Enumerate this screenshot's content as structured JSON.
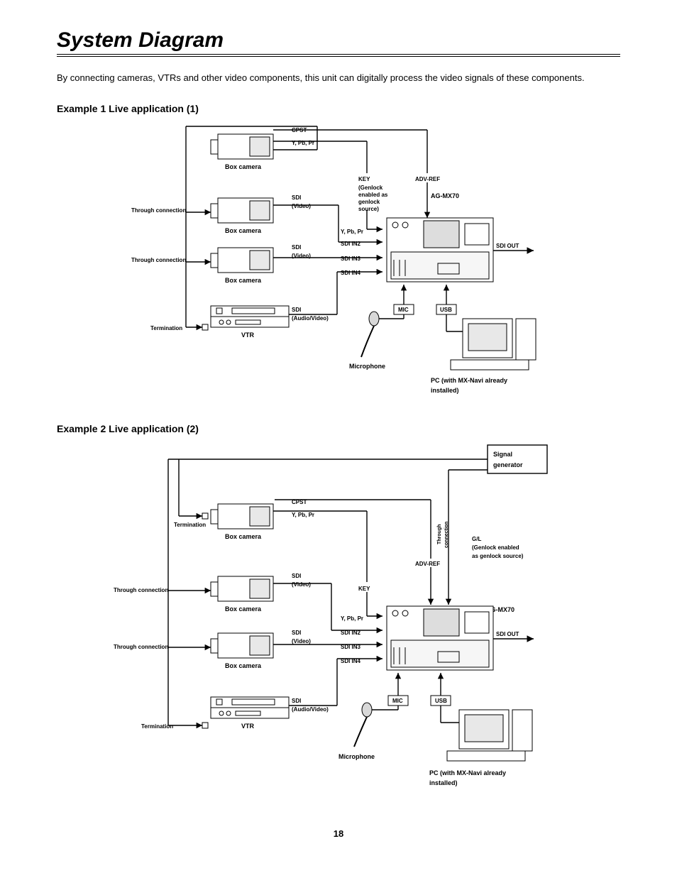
{
  "title": "System Diagram",
  "intro": "By connecting cameras, VTRs and other video components, this unit can digitally process the video signals of these components.",
  "ex1": {
    "heading": "Example 1  Live application (1)"
  },
  "ex2": {
    "heading": "Example 2  Live application (2)"
  },
  "labels": {
    "box_camera": "Box camera",
    "vtr": "VTR",
    "microphone": "Microphone",
    "ag_mx70": "AG-MX70",
    "pc_line1": "PC (with MX-Navi already",
    "pc_line2": "installed)",
    "signal_generator1": "Signal",
    "signal_generator2": "generator",
    "through_connection": "Through connection",
    "termination": "Termination",
    "cpst": "CPST",
    "ypbpr": "Y, Pb, Pr",
    "sdi": "SDI",
    "video": "(Video)",
    "audio_video": "(Audio/Video)",
    "key": "KEY",
    "key_genlock1": "(Genlock",
    "key_genlock2": "enabled as",
    "key_genlock3": "genlock",
    "key_genlock4": "source)",
    "adv_ref": "ADV-REF",
    "sdi_in2": "SDI IN2",
    "sdi_in3": "SDI IN3",
    "sdi_in4": "SDI IN4",
    "sdi_out": "SDI OUT",
    "mic": "MIC",
    "usb": "USB",
    "gl": "G/L",
    "gl_line1": "(Genlock enabled",
    "gl_line2": "as genlock source)"
  },
  "page_number": "18"
}
